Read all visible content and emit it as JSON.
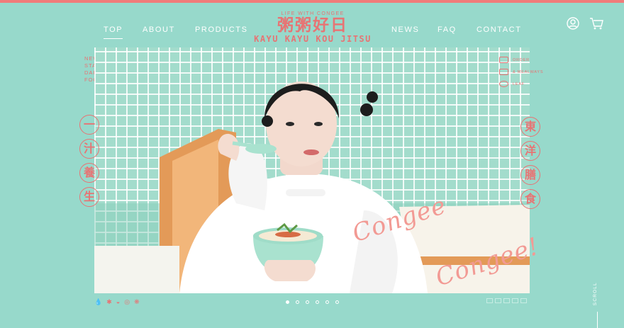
{
  "colors": {
    "background": "#97d9cb",
    "accent": "#e77474",
    "topbar": "#f07c7a"
  },
  "nav": {
    "top": "TOP",
    "about": "ABOUT",
    "products": "PRODUCTS",
    "news": "NEWS",
    "faq": "FAQ",
    "contact": "CONTACT"
  },
  "logo": {
    "tagline": "LIFE WITH CONGEE",
    "kanji": "粥粥好日",
    "roman": "KAYU KAYU KOU JITSU"
  },
  "header_icons": {
    "account": "user-icon",
    "cart": "cart-icon"
  },
  "tagline": [
    "NEW",
    "STANDARD",
    "DAILY",
    "FOOD"
  ],
  "left_chars": [
    "一",
    "汁",
    "養",
    "生"
  ],
  "right_chars": [
    "東",
    "洋",
    "膳",
    "食"
  ],
  "side_menu": [
    "ORDER",
    "& MEALWAYS",
    "LEAF"
  ],
  "script_text": [
    "Congee",
    "Congee!"
  ],
  "slider": {
    "count": 6,
    "active_index": 0
  },
  "scroll_label": "SCROLL",
  "footer_icons": [
    "drop-icon",
    "tree-icon",
    "bowl-icon",
    "eye-icon",
    "flower-icon"
  ]
}
